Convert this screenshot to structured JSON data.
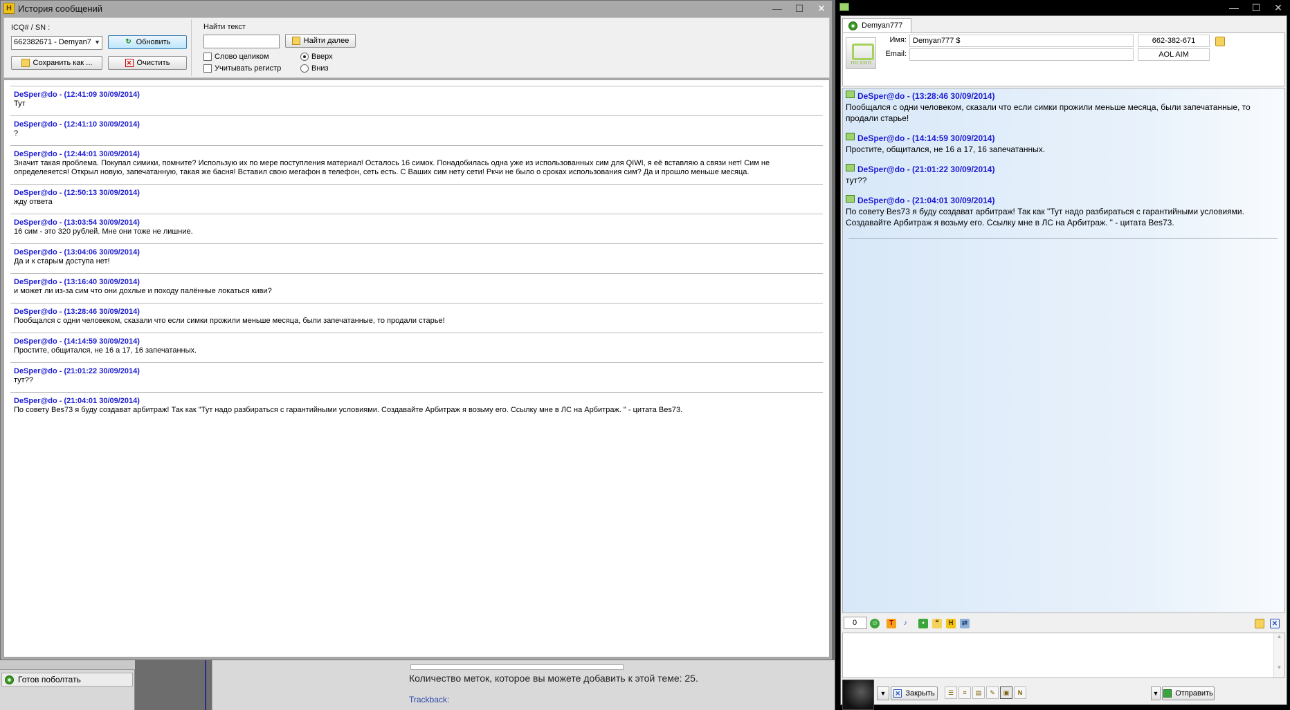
{
  "history_window": {
    "title": "История сообщений",
    "icon_letter": "H",
    "controls": {
      "minimize": "—",
      "maximize": "☐",
      "close": "✕"
    },
    "toolbar": {
      "sn_label": "ICQ# / SN :",
      "sn_value": "662382671 - Demyan7",
      "refresh_label": "Обновить",
      "save_label": "Сохранить как ...",
      "clear_label": "Очистить",
      "find_label": "Найти текст",
      "find_value": "",
      "find_next_label": "Найти далее",
      "whole_word_label": "Слово целиком",
      "match_case_label": "Учитывать регистр",
      "up_label": "Вверх",
      "down_label": "Вниз"
    },
    "messages": [
      {
        "header": "DeSper@do - (12:41:09 30/09/2014)",
        "text": "Тут"
      },
      {
        "header": "DeSper@do - (12:41:10 30/09/2014)",
        "text": "?"
      },
      {
        "header": "DeSper@do - (12:44:01 30/09/2014)",
        "text": "Значит такая проблема. Покупал симики, помните? Использую их по мере поступления материал! Осталось 16 симок. Понадобилась одна уже из использованных сим для QIWI, я её вставляю а связи нет! Сим не определеяется! Открыл новую, запечатанную, такая же басня! Вставил свою мегафон в телефон, сеть есть. С Ваших сим нету сети! Ркчи не было о сроках использования сим? Да и прошло меньше месяца."
      },
      {
        "header": "DeSper@do - (12:50:13 30/09/2014)",
        "text": "жду ответа"
      },
      {
        "header": "DeSper@do - (13:03:54 30/09/2014)",
        "text": "16 сим - это 320 рублей. Мне они тоже не лишние."
      },
      {
        "header": "DeSper@do - (13:04:06 30/09/2014)",
        "text": "Да и к старым доступа нет!"
      },
      {
        "header": "DeSper@do - (13:16:40 30/09/2014)",
        "text": "и может ли из-за сим что они дохлые и походу палённые локаться киви?"
      },
      {
        "header": "DeSper@do - (13:28:46 30/09/2014)",
        "text": "Пообщался с одни человеком, сказали что если симки прожили меньше месяца, были запечатанные, то продали старье!"
      },
      {
        "header": "DeSper@do - (14:14:59 30/09/2014)",
        "text": "Простите, общитался, не 16 а 17, 16 запечатанных."
      },
      {
        "header": "DeSper@do - (21:01:22 30/09/2014)",
        "text": "тут??"
      },
      {
        "header": "DeSper@do - (21:04:01 30/09/2014)",
        "text": "По совету Bes73 я буду создават арбитраж! Так как \"Тут надо разбираться с гарантийными условиями. Создавайте Арбитраж я возьму его. Ссылку мне в ЛС на Арбитраж. \" - цитата Bes73."
      }
    ]
  },
  "chat_window": {
    "controls": {
      "minimize": "—",
      "maximize": "☐",
      "close": "✕"
    },
    "tab_label": "Demyan777",
    "avatar_text": "no icon",
    "name_label": "Имя:",
    "name_value": "Demyan777  $",
    "email_label": "Email:",
    "email_value": "",
    "uin_value": "662-382-671",
    "protocol_value": "AOL AIM",
    "messages": [
      {
        "header": "DeSper@do - (13:28:46 30/09/2014)",
        "text": "Пообщался с одни человеком, сказали что если симки прожили меньше месяца, были запечатанные, то продали старье!"
      },
      {
        "header": "DeSper@do - (14:14:59 30/09/2014)",
        "text": "Простите, общитался, не 16 а 17, 16 запечатанных."
      },
      {
        "header": "DeSper@do - (21:01:22 30/09/2014)",
        "text": "тут??"
      },
      {
        "header": "DeSper@do - (21:04:01 30/09/2014)",
        "text": "По совету Bes73 я буду создават арбитраж! Так как \"Тут надо разбираться с гарантийными условиями. Создавайте Арбитраж я возьму его. Ссылку мне в ЛС на Арбитраж. \" - цитата Bes73."
      }
    ],
    "char_counter": "0",
    "close_label": "Закрыть",
    "send_label": "Отправить"
  },
  "background": {
    "status_label": "Готов поболтать",
    "tags_text": "Количество меток, которое вы можете добавить к этой теме: 25.",
    "trackback_label": "Trackback:"
  }
}
